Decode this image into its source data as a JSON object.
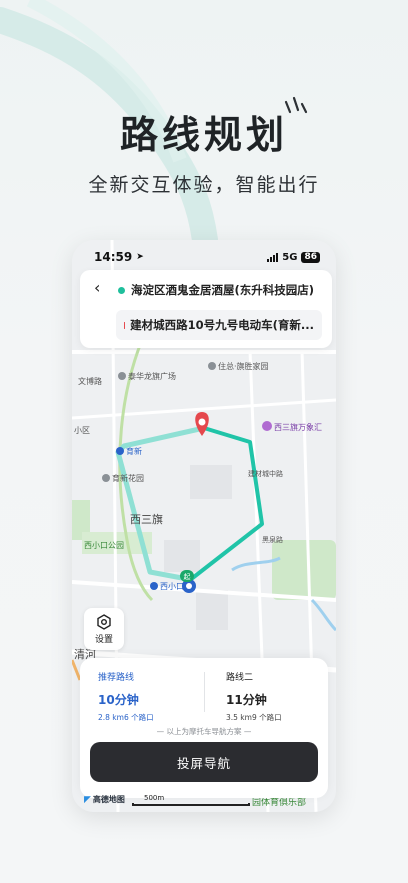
{
  "promo": {
    "title": "路线规划",
    "subtitle": "全新交互体验，智能出行"
  },
  "status_bar": {
    "time": "14:59",
    "network": "5G",
    "battery": "86"
  },
  "route": {
    "from": "海淀区酒鬼金居酒屋(东升科技园店)",
    "to": "建材城西路10号九号电动车(育新...",
    "from_color": "#1fbf9c",
    "to_color": "#e5484d"
  },
  "map": {
    "labels": {
      "area_1": "泰华龙旗广场",
      "area_2": "住总·旗胜家园",
      "area_3": "西三旗万象汇",
      "area_4": "育新",
      "area_5": "育新花园",
      "area_6": "西三旗",
      "area_7": "西小口公园",
      "area_8": "西小口",
      "road_1": "文博路",
      "road_2": "小区",
      "road_3": "建材城中路",
      "road_4": "黑泉路",
      "area_9": "清河",
      "area_10": "园体育俱乐部"
    },
    "start_badge": "起",
    "route_color": "#20c4a8",
    "alt_route_color": "#8fe0d4"
  },
  "controls": {
    "settings_label": "设置"
  },
  "routes_panel": {
    "options": [
      {
        "name": "推荐路线",
        "time": "10分钟",
        "meta": "2.8 km6 个路口"
      },
      {
        "name": "路线二",
        "time": "11分钟",
        "meta": "3.5 km9 个路口"
      }
    ],
    "hint": "— 以上为摩托车导航方案 —",
    "button": "投屏导航"
  },
  "map_footer": {
    "logo": "高德地图",
    "scale": "500m"
  }
}
